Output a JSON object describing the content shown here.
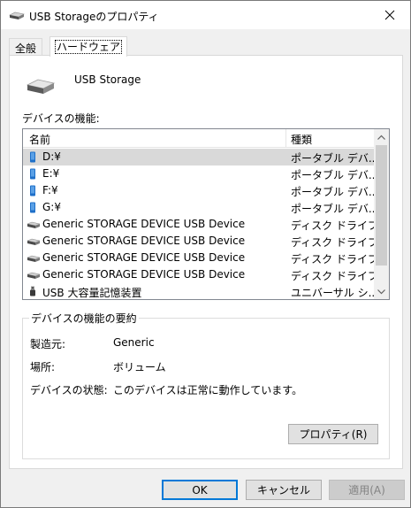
{
  "window": {
    "title": "USB Storageのプロパティ"
  },
  "tabs": [
    {
      "label": "全般",
      "active": false
    },
    {
      "label": "ハードウェア",
      "active": true
    }
  ],
  "device": {
    "name": "USB Storage",
    "icon": "drive-icon"
  },
  "functions_label": "デバイスの機能:",
  "list": {
    "columns": [
      "名前",
      "種類"
    ],
    "rows": [
      {
        "name": "D:¥",
        "type": "ポータブル デバ...",
        "icon": "portable-device-icon",
        "selected": true
      },
      {
        "name": "E:¥",
        "type": "ポータブル デバ...",
        "icon": "portable-device-icon",
        "selected": false
      },
      {
        "name": "F:¥",
        "type": "ポータブル デバ...",
        "icon": "portable-device-icon",
        "selected": false
      },
      {
        "name": "G:¥",
        "type": "ポータブル デバ...",
        "icon": "portable-device-icon",
        "selected": false
      },
      {
        "name": "Generic STORAGE DEVICE USB Device",
        "type": "ディスク ドライブ",
        "icon": "disk-drive-icon",
        "selected": false
      },
      {
        "name": "Generic STORAGE DEVICE USB Device",
        "type": "ディスク ドライブ",
        "icon": "disk-drive-icon",
        "selected": false
      },
      {
        "name": "Generic STORAGE DEVICE USB Device",
        "type": "ディスク ドライブ",
        "icon": "disk-drive-icon",
        "selected": false
      },
      {
        "name": "Generic STORAGE DEVICE USB Device",
        "type": "ディスク ドライブ",
        "icon": "disk-drive-icon",
        "selected": false
      },
      {
        "name": "USB 大容量記憶装置",
        "type": "ユニバーサル シ...",
        "icon": "usb-plug-icon",
        "selected": false
      }
    ]
  },
  "summary": {
    "title": "デバイスの機能の要約",
    "manufacturer_label": "製造元:",
    "manufacturer_value": "Generic",
    "location_label": "場所:",
    "location_value": "ボリューム",
    "status_label": "デバイスの状態:",
    "status_value": "このデバイスは正常に動作しています。",
    "properties_button": "プロパティ(R)"
  },
  "buttons": {
    "ok": "OK",
    "cancel": "キャンセル",
    "apply": "適用(A)"
  },
  "colors": {
    "selection": "#d9d9d9",
    "focus_border": "#0078d7",
    "portable_icon": "#1e6fc8"
  }
}
